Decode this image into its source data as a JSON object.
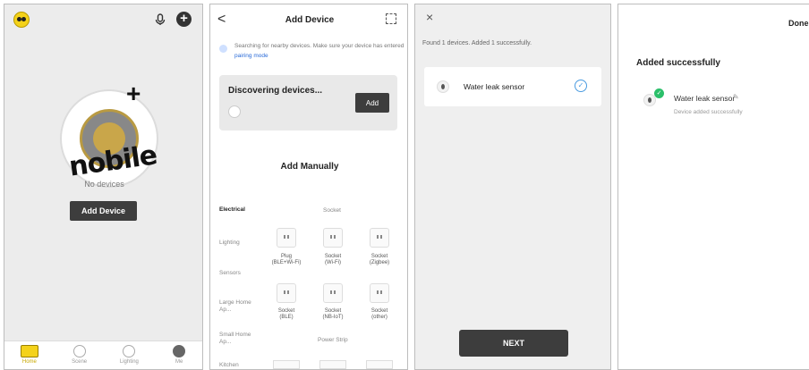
{
  "panel1": {
    "brand_text": "nobile",
    "hero_plus": "+",
    "add_icon": "+",
    "empty_text": "No devices",
    "add_device_label": "Add Device",
    "tabs": [
      {
        "icon": "home-icon",
        "label": "Home",
        "active": true
      },
      {
        "icon": "scene-icon",
        "label": "Scene"
      },
      {
        "icon": "lighting-icon",
        "label": "Lighting"
      },
      {
        "icon": "me-icon",
        "label": "Me"
      }
    ]
  },
  "panel2": {
    "back_glyph": "<",
    "title": "Add Device",
    "hint_text": "Searching for nearby devices. Make sure your device has entered",
    "hint_link": "pairing mode",
    "discovering_label": "Discovering devices...",
    "add_label": "Add",
    "manual_title": "Add Manually",
    "categories": [
      "Electrical",
      "Lighting",
      "Sensors",
      "Large Home Ap...",
      "Small Home Ap...",
      "Kitchen"
    ],
    "subheads": {
      "socket": "Socket",
      "power_strip": "Power Strip"
    },
    "devices": [
      {
        "line1": "Plug",
        "line2": "(BLE+Wi-Fi)"
      },
      {
        "line1": "Socket",
        "line2": "(Wi-Fi)"
      },
      {
        "line1": "Socket",
        "line2": "(Zigbee)"
      },
      {
        "line1": "Socket",
        "line2": "(BLE)"
      },
      {
        "line1": "Socket",
        "line2": "(NB-IoT)"
      },
      {
        "line1": "Socket",
        "line2": "(other)"
      }
    ]
  },
  "panel3": {
    "close_glyph": "×",
    "found_text": "Found 1 devices. Added 1 successfully.",
    "device_name": "Water leak sensor",
    "check_glyph": "✓",
    "next_label": "NEXT"
  },
  "panel4": {
    "done_label": "Done",
    "title": "Added successfully",
    "badge_glyph": "✓",
    "device_name": "Water leak sensor",
    "pencil_glyph": "✎",
    "status_text": "Device added successfully"
  }
}
